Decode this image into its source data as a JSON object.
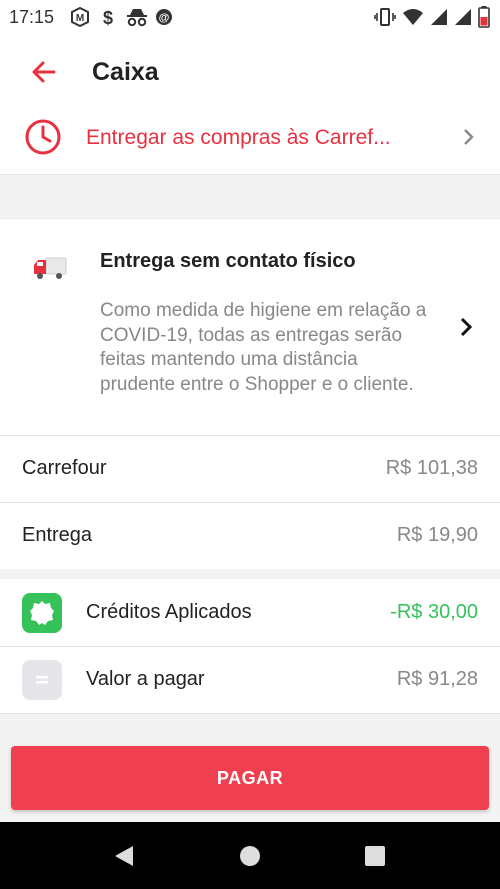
{
  "status_bar": {
    "time": "17:15",
    "left_icons": [
      "m-badge-icon",
      "dollar-app-icon",
      "incognito-icon",
      "sync-icon"
    ],
    "right_icons": [
      "vibrate-icon",
      "wifi-icon",
      "signal-icon",
      "signal-icon",
      "battery-icon"
    ]
  },
  "header": {
    "title": "Caixa",
    "back_icon": "arrow-left-icon"
  },
  "schedule": {
    "text": "Entregar as compras às Carref...",
    "icon": "clock-icon"
  },
  "notice": {
    "title": "Entrega sem contato físico",
    "body": "Como medida de higiene em relação a COVID-19, todas as entregas serão feitas mantendo uma distância prudente entre o Shopper e o cliente.",
    "icon": "truck-icon"
  },
  "summary": {
    "store_label": "Carrefour",
    "store_value": "R$ 101,38",
    "delivery_label": "Entrega",
    "delivery_value": "R$ 19,90",
    "credits_label": "Créditos Aplicados",
    "credits_value": "-R$ 30,00",
    "total_label": "Valor a pagar",
    "total_value": "R$ 91,28"
  },
  "pay_button": {
    "label": "PAGAR"
  },
  "colors": {
    "accent": "#e8313f",
    "button": "#f0404f",
    "credit": "#35c25a",
    "muted": "#888888"
  }
}
